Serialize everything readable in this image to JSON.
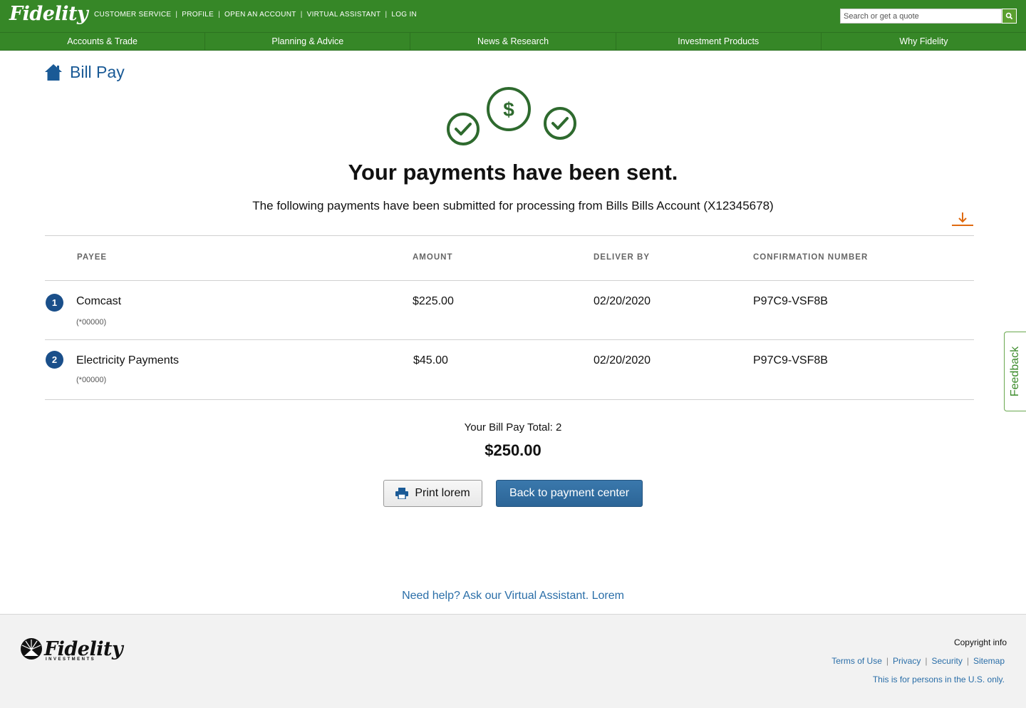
{
  "header": {
    "logo": "Fidelity",
    "util_links": [
      "CUSTOMER SERVICE",
      "PROFILE",
      "OPEN AN ACCOUNT",
      "VIRTUAL ASSISTANT",
      "LOG IN"
    ],
    "search_placeholder": "Search or get a quote",
    "brand_color": "#368727"
  },
  "nav": {
    "items": [
      "Accounts & Trade",
      "Planning & Advice",
      "News & Research",
      "Investment Products",
      "Why Fidelity"
    ]
  },
  "page": {
    "title": "Bill Pay",
    "headline": "Your payments have been sent.",
    "subline": "The following payments have been submitted for processing from Bills Bills Account (X12345678)"
  },
  "table": {
    "headers": {
      "payee": "PAYEE",
      "amount": "AMOUNT",
      "deliver_by": "DELIVER BY",
      "confirmation": "CONFIRMATION NUMBER"
    },
    "rows": [
      {
        "index": "1",
        "payee": "Comcast",
        "account": "(*00000)",
        "amount": "$225.00",
        "deliver_by": "02/20/2020",
        "confirmation": "P97C9-VSF8B"
      },
      {
        "index": "2",
        "payee": "Electricity Payments",
        "account": "(*00000)",
        "amount": "$45.00",
        "deliver_by": "02/20/2020",
        "confirmation": "P97C9-VSF8B"
      }
    ]
  },
  "totals": {
    "label": "Your Bill Pay Total: 2",
    "amount": "$250.00"
  },
  "buttons": {
    "print": "Print lorem",
    "back": "Back to payment center"
  },
  "help_link": "Need help? Ask our Virtual Assistant. Lorem",
  "feedback": "Feedback",
  "footer": {
    "logo": "Fidelity",
    "logo_sub": "INVESTMENTS",
    "copyright": "Copyright info",
    "links": [
      "Terms of Use",
      "Privacy",
      "Security",
      "Sitemap"
    ],
    "us_only": "This is for persons in the U.S. only."
  },
  "icons": {
    "home": "home-icon",
    "check": "check-circle-icon",
    "dollar": "dollar-circle-icon",
    "download": "download-icon",
    "print": "printer-icon",
    "search": "search-icon"
  }
}
